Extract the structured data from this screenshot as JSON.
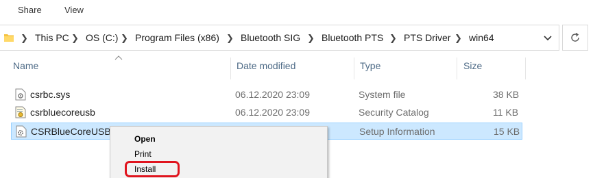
{
  "ribbon": {
    "tabs": [
      "Share",
      "View"
    ]
  },
  "address_bar": {
    "breadcrumbs": [
      "This PC",
      "OS (C:)",
      "Program Files (x86)",
      "Bluetooth SIG",
      "Bluetooth PTS",
      "PTS Driver",
      "win64"
    ],
    "folder_icon": "folder-icon",
    "dropdown_icon": "chevron-down-icon",
    "refresh_icon": "refresh-icon"
  },
  "columns": {
    "name": "Name",
    "date_modified": "Date modified",
    "type": "Type",
    "size": "Size"
  },
  "files": [
    {
      "name": "csrbc.sys",
      "date": "06.12.2020 23:09",
      "type": "System file",
      "size": "38 KB",
      "icon": "system-file-icon",
      "selected": false
    },
    {
      "name": "csrbluecoreusb",
      "date": "06.12.2020 23:09",
      "type": "Security Catalog",
      "size": "11 KB",
      "icon": "security-catalog-icon",
      "selected": false
    },
    {
      "name": "CSRBlueCoreUSB",
      "date": "",
      "type": "Setup Information",
      "size": "15 KB",
      "icon": "setup-information-icon",
      "selected": true
    }
  ],
  "context_menu": {
    "open": "Open",
    "print": "Print",
    "install": "Install",
    "highlight_color": "#e0141e"
  },
  "colors": {
    "selection_bg": "#cce8ff",
    "selection_border": "#99d1ff",
    "header_text": "#4d6a86"
  }
}
